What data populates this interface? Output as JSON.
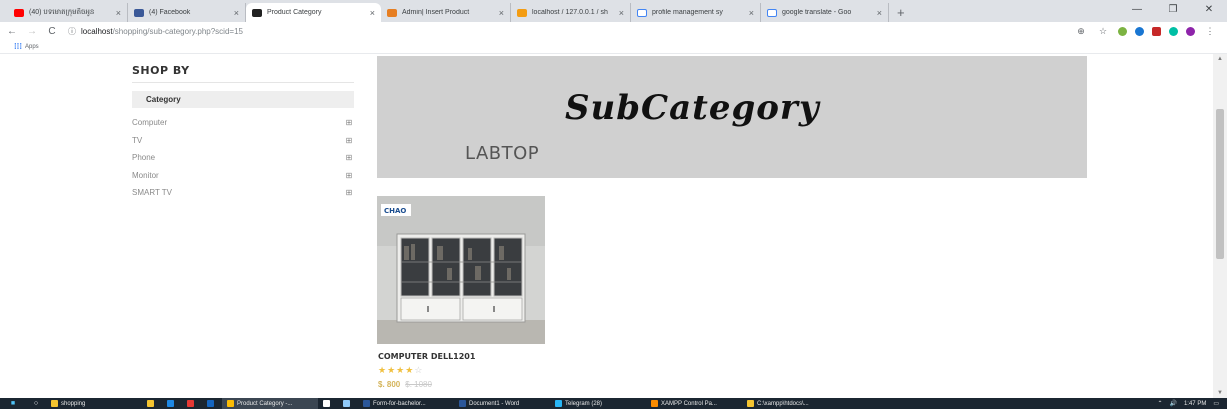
{
  "browser": {
    "tabs": [
      {
        "title": "(40) បទមោតក្រុមតិចអូន",
        "fav_color": "#ff0000"
      },
      {
        "title": "(4) Facebook",
        "fav_color": "#3b5998"
      },
      {
        "title": "Product Category",
        "fav_color": "#222222",
        "active": true
      },
      {
        "title": "Admin| Insert Product",
        "fav_color": "#e67e22"
      },
      {
        "title": "localhost / 127.0.0.1 / sh",
        "fav_color": "#f39c12"
      },
      {
        "title": "profile management sy",
        "fav_color": "#ffffff"
      },
      {
        "title": "google translate - Goo",
        "fav_color": "#ffffff"
      }
    ],
    "tab_close": "×",
    "new_tab": "+",
    "address": {
      "host": "localhost",
      "path": "/shopping/sub-category.php?scid=15"
    },
    "bookmarks": {
      "apps_label": "Apps"
    }
  },
  "page": {
    "sidebar": {
      "heading": "SHOP BY",
      "category_title": "Category",
      "items": [
        {
          "label": "Computer"
        },
        {
          "label": "TV"
        },
        {
          "label": "Phone"
        },
        {
          "label": "Monitor"
        },
        {
          "label": "SMART TV"
        }
      ],
      "expand_icon": "⊞"
    },
    "banner": {
      "title": "SubCategory",
      "subtitle": "LABTOP"
    },
    "product": {
      "name": "COMPUTER DELL1201",
      "rating": 4,
      "rating_max": 5,
      "price": "$. 800",
      "old_price": "$. 1080",
      "brand_badge": "CHAO"
    }
  },
  "taskbar": {
    "items": [
      {
        "label": "shopping",
        "color": "#f4c430"
      },
      {
        "label": "",
        "color": "#f4c430"
      },
      {
        "label": "",
        "color": "#1e88e5"
      },
      {
        "label": "",
        "color": "#e53935"
      },
      {
        "label": "",
        "color": "#1565c0"
      },
      {
        "label": "Product Category -...",
        "color": "#fbbc05",
        "active": true
      },
      {
        "label": "",
        "color": "#ffffff"
      },
      {
        "label": "",
        "color": "#90caf9"
      },
      {
        "label": "Form-for-bachelor...",
        "color": "#2b579a"
      },
      {
        "label": "Document1 - Word",
        "color": "#2b579a"
      },
      {
        "label": "Telegram (28)",
        "color": "#29b6f6"
      },
      {
        "label": "XAMPP Control Pa...",
        "color": "#fb8c00"
      },
      {
        "label": "C:\\xampp\\htdocs\\...",
        "color": "#f4c430"
      }
    ],
    "time": "1:47 PM"
  }
}
